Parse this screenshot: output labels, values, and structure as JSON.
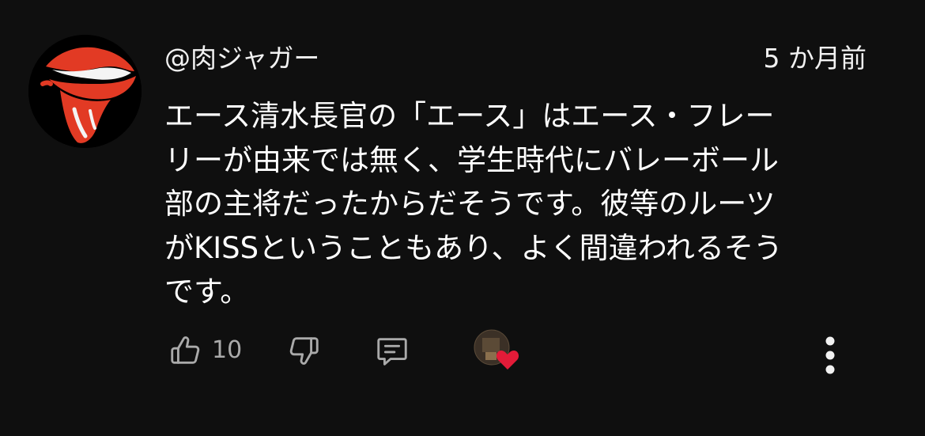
{
  "comment": {
    "author": {
      "handle": "@肉ジャガー",
      "avatar_icon": "tongue-logo-icon"
    },
    "timestamp": "5 か月前",
    "text_lines": [
      "エース清水長官の「エース」はエース・フレー",
      "リーが由来では無く、学生時代にバレーボール",
      "部の主将だったからだそうです。彼等のルーツ",
      "がKISSということもあり、よく間違われるそう",
      "です。"
    ]
  },
  "actions": {
    "like_icon": "thumbs-up-icon",
    "like_count": "10",
    "dislike_icon": "thumbs-down-icon",
    "reply_icon": "reply-icon",
    "creator_heart_icon": "creator-heart-icon",
    "more_icon": "more-vert-icon"
  },
  "colors": {
    "background": "#0f0f0f",
    "text": "#f1f1f1",
    "secondary_text": "#aaaaaa",
    "avatar_red": "#e23a24",
    "heart": "#e31b38"
  }
}
